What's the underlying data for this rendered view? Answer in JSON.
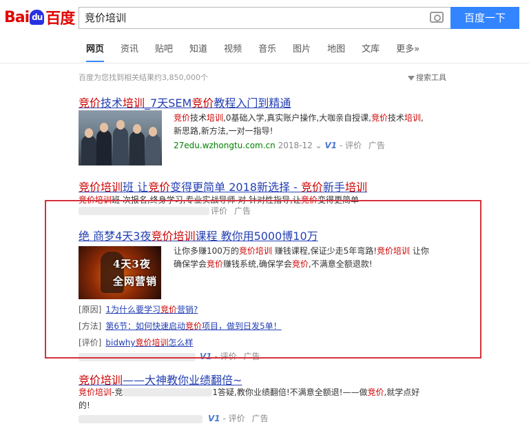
{
  "logo": {
    "part1": "Bai",
    "part2": "du",
    "part3": "百度"
  },
  "search": {
    "value": "竞价培训",
    "button": "百度一下"
  },
  "tabs": [
    "网页",
    "资讯",
    "贴吧",
    "知道",
    "视频",
    "音乐",
    "图片",
    "地图",
    "文库",
    "更多»"
  ],
  "stats": "百度为您找到相关结果约3,850,000个",
  "tools": "搜索工具",
  "r1": {
    "title": [
      "竞价",
      "技术",
      "培训",
      "_7天SEM",
      "竞价",
      "教程入门到精通"
    ],
    "abs1": [
      "竞价",
      "技术",
      "培训",
      ",0基础入学,真实账户操作,大咖亲自授课,",
      "竞价",
      "技术",
      "培训",
      ","
    ],
    "abs2": "新思路,新方法,一对一指导!",
    "url": "27edu.wzhongtu.com.cn",
    "date": "2018-12",
    "v1": "V1",
    "eval": "评价",
    "ad": "广告"
  },
  "r2": {
    "title": [
      "竞价",
      "培训",
      "班 让",
      "竞价",
      "变得更简单 2018新选择 - ",
      "竞价",
      "新手",
      "培训"
    ],
    "abs": [
      "竞价",
      "培训",
      "班     次报名,终身学习,专业实战导师   对   针对性指导,让",
      "竞价",
      "变得更简单"
    ],
    "eval": "评价",
    "ad": "广告"
  },
  "r3": {
    "title": [
      "绝 商梦4天3夜",
      "竞价",
      "培训",
      "课程 教你用5000博10万"
    ],
    "abs1": [
      "让你多赚100万的",
      "竞价",
      "培训",
      " 赚钱课程,保证少走5年弯路!",
      "竞价",
      "培训",
      " 让你"
    ],
    "abs2": [
      "确保学会",
      "竞价",
      "赚钱系统,确保学会",
      "竞价",
      ",不满意全额退款!"
    ],
    "thumb_line1": "4天3夜",
    "thumb_line2": "全网营销",
    "sub": [
      {
        "tag": "[原因]",
        "text": [
          "1为什么要学习",
          "竞价",
          "营销?"
        ]
      },
      {
        "tag": "[方法]",
        "text": [
          "第6节：如何快速启动",
          "竞价",
          "项目，做到日发5单！"
        ]
      },
      {
        "tag": "[评价]",
        "text": [
          "bidwhy",
          "竞价",
          "培训",
          "怎么样"
        ]
      }
    ],
    "v1": "V1",
    "eval": "评价",
    "ad": "广告"
  },
  "r4": {
    "title": [
      "竞价",
      "培训",
      "——大神教你业绩翻倍~"
    ],
    "abs1": [
      "竞价",
      "培训",
      "-竞",
      "1答疑,教你业绩翻倍!不满意全额退!——做",
      "竞价",
      ",就学点好"
    ],
    "abs2": "的!",
    "v1": "V1",
    "eval": "评价",
    "ad": "广告"
  },
  "colors": {
    "accent": "#3385ff",
    "link": "#2440b3",
    "highlight": "#cc0000",
    "url": "#008000",
    "box": "#d6303b"
  }
}
